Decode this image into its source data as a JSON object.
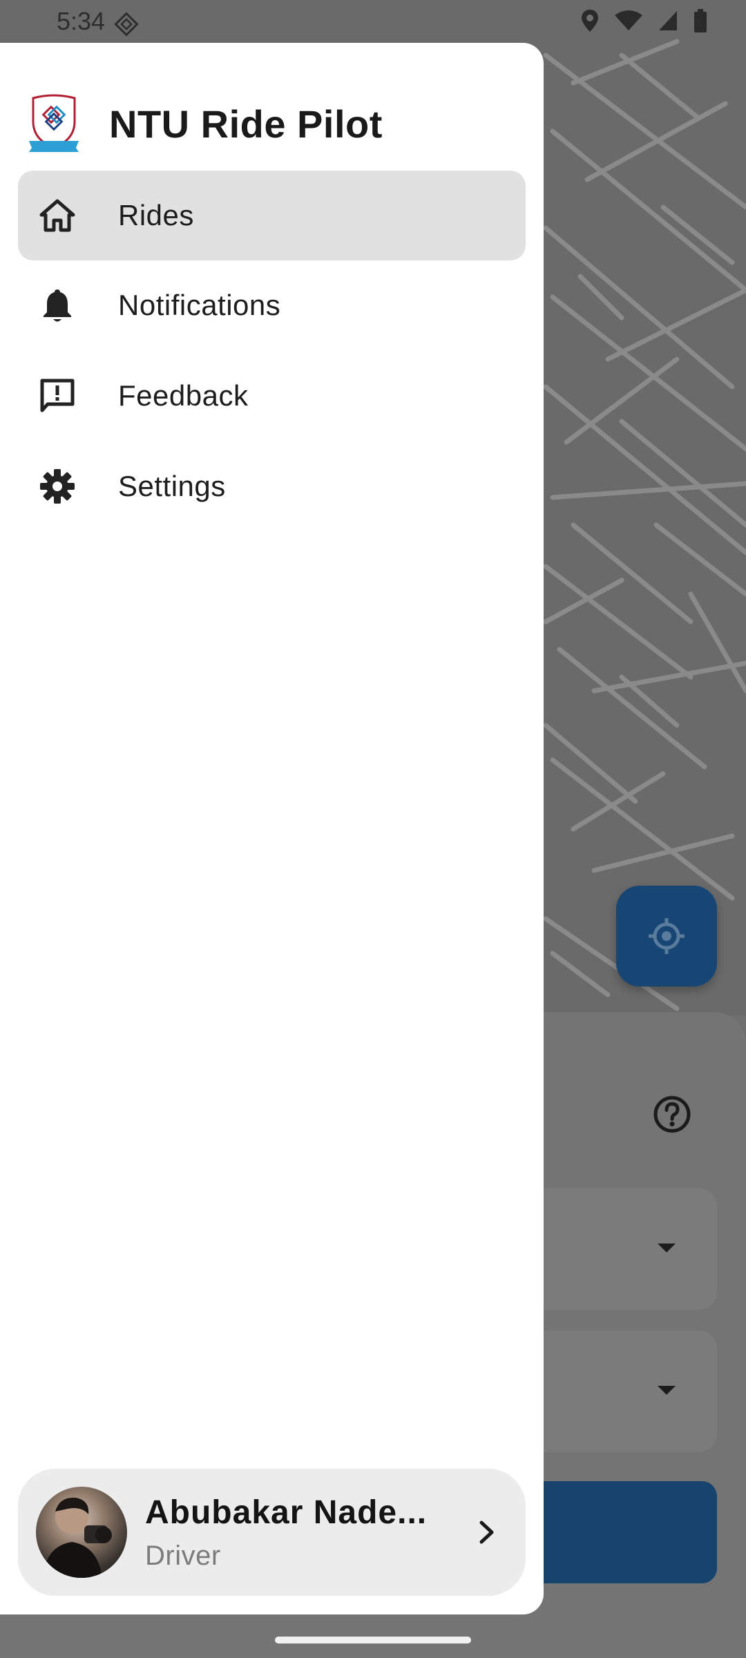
{
  "status_bar": {
    "time": "5:34",
    "icons": [
      "lens-icon",
      "location-icon",
      "wifi-icon",
      "signal-icon",
      "battery-icon"
    ]
  },
  "drawer": {
    "app_title": "NTU Ride Pilot",
    "logo": "ntu-logo",
    "nav_items": [
      {
        "label": "Rides",
        "icon": "home-icon",
        "active": true
      },
      {
        "label": "Notifications",
        "icon": "bell-icon",
        "active": false
      },
      {
        "label": "Feedback",
        "icon": "feedback-icon",
        "active": false
      },
      {
        "label": "Settings",
        "icon": "gear-icon",
        "active": false
      }
    ],
    "profile": {
      "name": "Abubakar Nade...",
      "role": "Driver"
    }
  },
  "colors": {
    "accent": "#174675",
    "active_item_bg": "#e1e1e1",
    "scrim": "#6f6f6f"
  }
}
